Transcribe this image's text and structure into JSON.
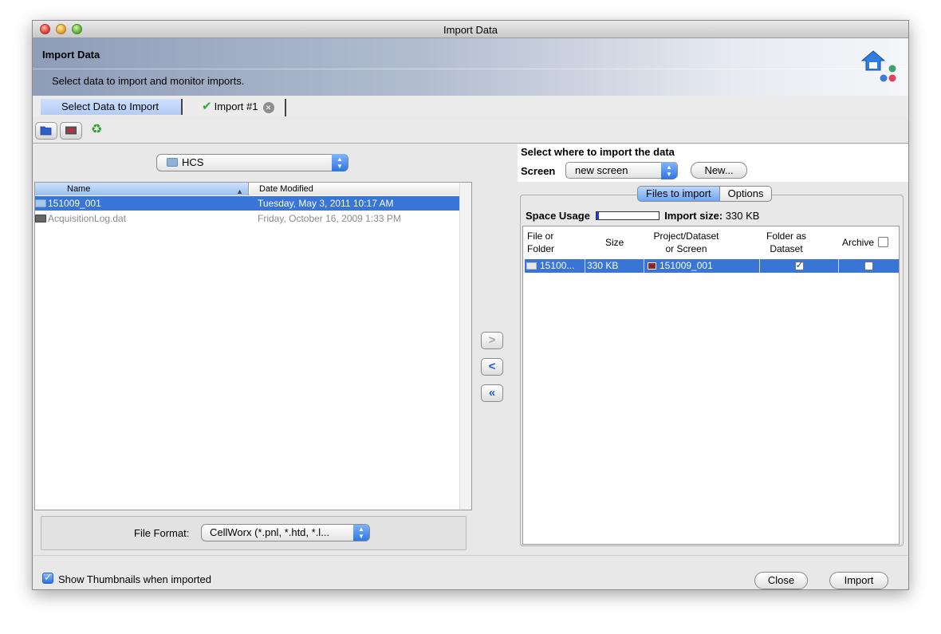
{
  "window": {
    "title": "Import Data"
  },
  "banner": {
    "title": "Import Data",
    "subtitle": "Select data to import and monitor imports."
  },
  "tabs": [
    {
      "label": "Select Data to Import",
      "active": true
    },
    {
      "label": "Import #1",
      "active": false
    }
  ],
  "toolbar": {
    "icons": [
      "folder-open-icon",
      "import-screen-icon",
      "refresh-icon"
    ]
  },
  "browser": {
    "folder": "HCS",
    "columns": {
      "name": "Name",
      "date": "Date Modified"
    },
    "rows": [
      {
        "name": "151009_001",
        "date": "Tuesday, May 3, 2011 10:17 AM",
        "type": "folder",
        "selected": true
      },
      {
        "name": "AcquisitionLog.dat",
        "date": "Friday, October 16, 2009 1:33 PM",
        "type": "file",
        "selected": false
      }
    ],
    "format_label": "File Format:",
    "format_value": "CellWorx (*.pnl, *.htd, *.l..."
  },
  "arrows": {
    "add": ">",
    "remove": "<",
    "remove_all": "«"
  },
  "target": {
    "title": "Select where to import the data",
    "screen_label": "Screen",
    "screen_value": "new screen",
    "new_button": "New...",
    "tab_files": "Files to import",
    "tab_options": "Options",
    "space_label": "Space Usage",
    "space_fraction": 0.05,
    "import_size_label": "Import size:",
    "import_size_value": "330 KB",
    "columns": {
      "file_line1": "File or",
      "file_line2": "Folder",
      "size": "Size",
      "project_line1": "Project/Dataset",
      "project_line2": "or Screen",
      "folder_line1": "Folder as",
      "folder_line2": "Dataset",
      "archive": "Archive"
    },
    "rows": [
      {
        "file": "15100...",
        "size": "330 KB",
        "project": "151009_001",
        "folder_as_dataset": true,
        "archive": false
      }
    ]
  },
  "bottom": {
    "thumbnails_label": "Show Thumbnails when imported",
    "close_button": "Close",
    "import_button": "Import"
  },
  "colors": {
    "selection": "#3875d7",
    "banner_start": "#8e9db8",
    "space_fill": "#1d3fe0"
  }
}
